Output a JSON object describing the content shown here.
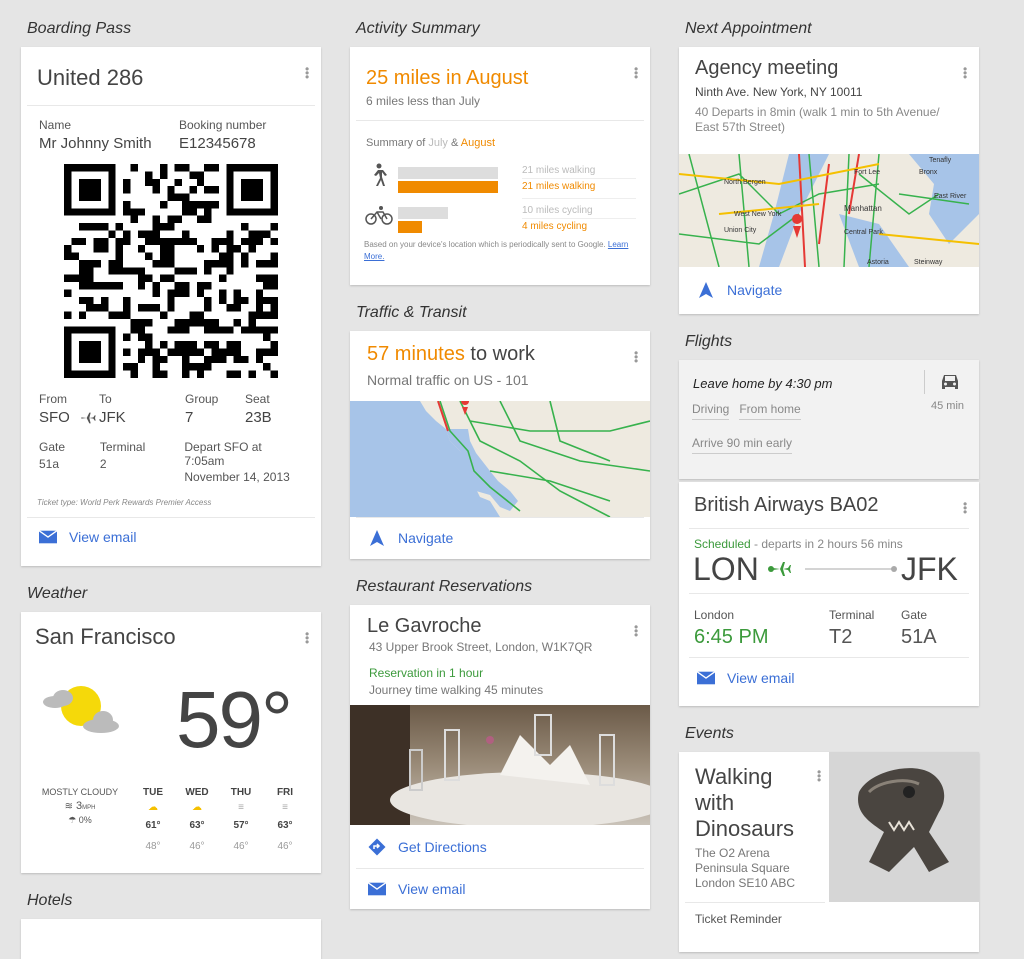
{
  "boarding": {
    "section": "Boarding Pass",
    "title": "United 286",
    "name_label": "Name",
    "name_value": "Mr Johnny Smith",
    "booking_label": "Booking number",
    "booking_value": "E12345678",
    "from_label": "From",
    "from_value": "SFO",
    "to_label": "To",
    "to_value": "JFK",
    "group_label": "Group",
    "group_value": "7",
    "seat_label": "Seat",
    "seat_value": "23B",
    "gate_label": "Gate",
    "gate_value": "51a",
    "terminal_label": "Terminal",
    "terminal_value": "2",
    "depart_line1": "Depart SFO at 7:05am",
    "depart_line2": "November 14, 2013",
    "ticket_type": "Ticket type: World Perk Rewards Premier Access",
    "action": "View email"
  },
  "weather": {
    "section": "Weather",
    "city": "San Francisco",
    "temp": "59°",
    "condition": "MOSTLY CLOUDY",
    "wind": "3",
    "wind_unit": "MPH",
    "precip": "0%",
    "days": [
      {
        "day": "TUE",
        "high": "61°",
        "low": "48°"
      },
      {
        "day": "WED",
        "high": "63°",
        "low": "46°"
      },
      {
        "day": "THU",
        "high": "57°",
        "low": "46°"
      },
      {
        "day": "FRI",
        "high": "63°",
        "low": "46°"
      }
    ]
  },
  "hotels": {
    "section": "Hotels"
  },
  "activity": {
    "section": "Activity Summary",
    "headline": "25 miles in August",
    "sub": "6 miles less than July",
    "summary_prefix": "Summary of",
    "summary_july": "July",
    "summary_amp": "&",
    "summary_aug": "August",
    "walk_july": "21 miles walking",
    "walk_aug": "21 miles walking",
    "cycle_july": "10 miles cycling",
    "cycle_aug": "4 miles cycling",
    "walk_july_frac": 1.0,
    "walk_aug_frac": 1.0,
    "cycle_july_frac": 0.5,
    "cycle_aug_frac": 0.24,
    "note": "Based on your device's location which is periodically sent to Google.",
    "learn_more": "Learn More."
  },
  "traffic": {
    "section": "Traffic & Transit",
    "minutes": "57 minutes",
    "to_work": " to work",
    "sub": "Normal traffic on US - 101",
    "action": "Navigate"
  },
  "restaurant": {
    "section": "Restaurant Reservations",
    "name": "Le Gavroche",
    "address": "43 Upper Brook Street, London, W1K7QR",
    "reservation": "Reservation in 1 hour",
    "journey": "Journey time walking 45 minutes",
    "directions": "Get Directions",
    "email": "View email"
  },
  "appointment": {
    "section": "Next Appointment",
    "title": "Agency meeting",
    "address": "Ninth Ave. New York, NY 10011",
    "departs": "40 Departs in 8min (walk 1 min to 5th Avenue/ East 57th Street)",
    "map_labels": [
      "North Bergen",
      "West New York",
      "Union City",
      "Manhattan",
      "Central Park",
      "Astoria",
      "Steinway",
      "Fort Lee",
      "Bronx",
      "East River",
      "Tenafly"
    ],
    "action": "Navigate"
  },
  "flights": {
    "section": "Flights",
    "leave": "Leave home by 4:30 pm",
    "driving": "Driving",
    "from_home": "From home",
    "arrive": "Arrive 90 min early",
    "drive_time": "45 min",
    "flight": "British Airways BA02",
    "scheduled": "Scheduled",
    "departs": " - departs in 2 hours 56 mins",
    "from": "LON",
    "to": "JFK",
    "city_label": "London",
    "time": "6:45 PM",
    "terminal_label": "Terminal",
    "terminal": "T2",
    "gate_label": "Gate",
    "gate": "51A",
    "action": "View email"
  },
  "events": {
    "section": "Events",
    "title": "Walking with Dinosaurs",
    "venue1": "The O2 Arena",
    "venue2": "Peninsula Square",
    "venue3": "London SE10 ABC",
    "reminder": "Ticket Reminder"
  },
  "colors": {
    "accent": "#3b6fd6",
    "orange": "#f08a00",
    "green": "#3c9a3c",
    "bg": "#e5e5e5"
  }
}
